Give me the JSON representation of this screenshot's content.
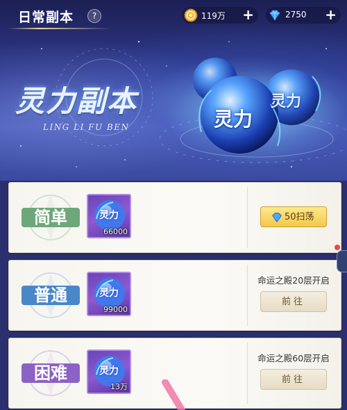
{
  "header": {
    "title": "日常副本",
    "help_label": "?",
    "gold": {
      "icon": "coin-icon",
      "value": "119万",
      "plus": "+"
    },
    "gems": {
      "icon": "diamond-icon",
      "value": "2750",
      "plus": "+"
    }
  },
  "banner": {
    "logo_title": "灵力副本",
    "logo_subtitle": "LING LI FU BEN",
    "orb_front_label": "灵力",
    "orb_back_label": "灵力"
  },
  "dungeons": [
    {
      "difficulty": "简单",
      "accent": "#6ea77a",
      "reward_icon": "灵力",
      "reward_count": "66000",
      "requirement": "",
      "action_label": "50扫荡",
      "action_type": "sweep"
    },
    {
      "difficulty": "普通",
      "accent": "#4a87c9",
      "reward_icon": "灵力",
      "reward_count": "99000",
      "requirement": "命运之殿20层开启",
      "action_label": "前往",
      "action_type": "go"
    },
    {
      "difficulty": "困难",
      "accent": "#8c62c4",
      "reward_icon": "灵力",
      "reward_count": "13万",
      "requirement": "命运之殿60层开启",
      "action_label": "前往",
      "action_type": "go"
    }
  ]
}
